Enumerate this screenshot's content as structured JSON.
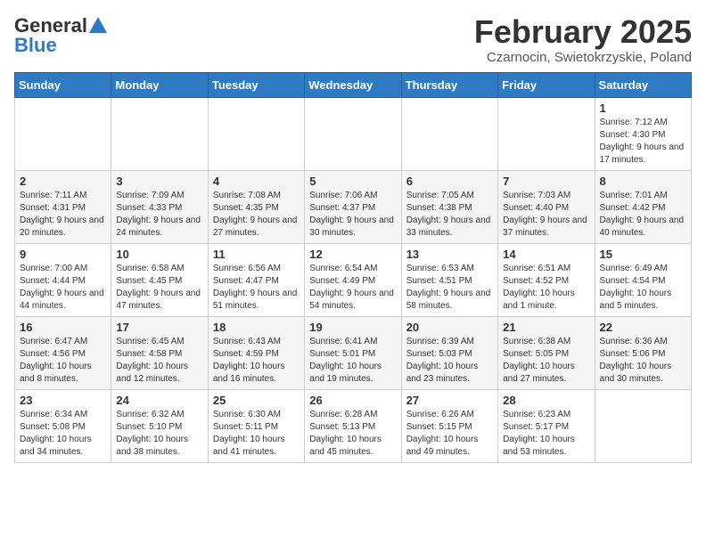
{
  "header": {
    "logo_line1": "General",
    "logo_line2": "Blue",
    "month": "February 2025",
    "location": "Czarnocin, Swietokrzyskie, Poland"
  },
  "days_of_week": [
    "Sunday",
    "Monday",
    "Tuesday",
    "Wednesday",
    "Thursday",
    "Friday",
    "Saturday"
  ],
  "weeks": [
    [
      {
        "day": "",
        "info": ""
      },
      {
        "day": "",
        "info": ""
      },
      {
        "day": "",
        "info": ""
      },
      {
        "day": "",
        "info": ""
      },
      {
        "day": "",
        "info": ""
      },
      {
        "day": "",
        "info": ""
      },
      {
        "day": "1",
        "info": "Sunrise: 7:12 AM\nSunset: 4:30 PM\nDaylight: 9 hours and 17 minutes."
      }
    ],
    [
      {
        "day": "2",
        "info": "Sunrise: 7:11 AM\nSunset: 4:31 PM\nDaylight: 9 hours and 20 minutes."
      },
      {
        "day": "3",
        "info": "Sunrise: 7:09 AM\nSunset: 4:33 PM\nDaylight: 9 hours and 24 minutes."
      },
      {
        "day": "4",
        "info": "Sunrise: 7:08 AM\nSunset: 4:35 PM\nDaylight: 9 hours and 27 minutes."
      },
      {
        "day": "5",
        "info": "Sunrise: 7:06 AM\nSunset: 4:37 PM\nDaylight: 9 hours and 30 minutes."
      },
      {
        "day": "6",
        "info": "Sunrise: 7:05 AM\nSunset: 4:38 PM\nDaylight: 9 hours and 33 minutes."
      },
      {
        "day": "7",
        "info": "Sunrise: 7:03 AM\nSunset: 4:40 PM\nDaylight: 9 hours and 37 minutes."
      },
      {
        "day": "8",
        "info": "Sunrise: 7:01 AM\nSunset: 4:42 PM\nDaylight: 9 hours and 40 minutes."
      }
    ],
    [
      {
        "day": "9",
        "info": "Sunrise: 7:00 AM\nSunset: 4:44 PM\nDaylight: 9 hours and 44 minutes."
      },
      {
        "day": "10",
        "info": "Sunrise: 6:58 AM\nSunset: 4:45 PM\nDaylight: 9 hours and 47 minutes."
      },
      {
        "day": "11",
        "info": "Sunrise: 6:56 AM\nSunset: 4:47 PM\nDaylight: 9 hours and 51 minutes."
      },
      {
        "day": "12",
        "info": "Sunrise: 6:54 AM\nSunset: 4:49 PM\nDaylight: 9 hours and 54 minutes."
      },
      {
        "day": "13",
        "info": "Sunrise: 6:53 AM\nSunset: 4:51 PM\nDaylight: 9 hours and 58 minutes."
      },
      {
        "day": "14",
        "info": "Sunrise: 6:51 AM\nSunset: 4:52 PM\nDaylight: 10 hours and 1 minute."
      },
      {
        "day": "15",
        "info": "Sunrise: 6:49 AM\nSunset: 4:54 PM\nDaylight: 10 hours and 5 minutes."
      }
    ],
    [
      {
        "day": "16",
        "info": "Sunrise: 6:47 AM\nSunset: 4:56 PM\nDaylight: 10 hours and 8 minutes."
      },
      {
        "day": "17",
        "info": "Sunrise: 6:45 AM\nSunset: 4:58 PM\nDaylight: 10 hours and 12 minutes."
      },
      {
        "day": "18",
        "info": "Sunrise: 6:43 AM\nSunset: 4:59 PM\nDaylight: 10 hours and 16 minutes."
      },
      {
        "day": "19",
        "info": "Sunrise: 6:41 AM\nSunset: 5:01 PM\nDaylight: 10 hours and 19 minutes."
      },
      {
        "day": "20",
        "info": "Sunrise: 6:39 AM\nSunset: 5:03 PM\nDaylight: 10 hours and 23 minutes."
      },
      {
        "day": "21",
        "info": "Sunrise: 6:38 AM\nSunset: 5:05 PM\nDaylight: 10 hours and 27 minutes."
      },
      {
        "day": "22",
        "info": "Sunrise: 6:36 AM\nSunset: 5:06 PM\nDaylight: 10 hours and 30 minutes."
      }
    ],
    [
      {
        "day": "23",
        "info": "Sunrise: 6:34 AM\nSunset: 5:08 PM\nDaylight: 10 hours and 34 minutes."
      },
      {
        "day": "24",
        "info": "Sunrise: 6:32 AM\nSunset: 5:10 PM\nDaylight: 10 hours and 38 minutes."
      },
      {
        "day": "25",
        "info": "Sunrise: 6:30 AM\nSunset: 5:11 PM\nDaylight: 10 hours and 41 minutes."
      },
      {
        "day": "26",
        "info": "Sunrise: 6:28 AM\nSunset: 5:13 PM\nDaylight: 10 hours and 45 minutes."
      },
      {
        "day": "27",
        "info": "Sunrise: 6:26 AM\nSunset: 5:15 PM\nDaylight: 10 hours and 49 minutes."
      },
      {
        "day": "28",
        "info": "Sunrise: 6:23 AM\nSunset: 5:17 PM\nDaylight: 10 hours and 53 minutes."
      },
      {
        "day": "",
        "info": ""
      }
    ]
  ]
}
